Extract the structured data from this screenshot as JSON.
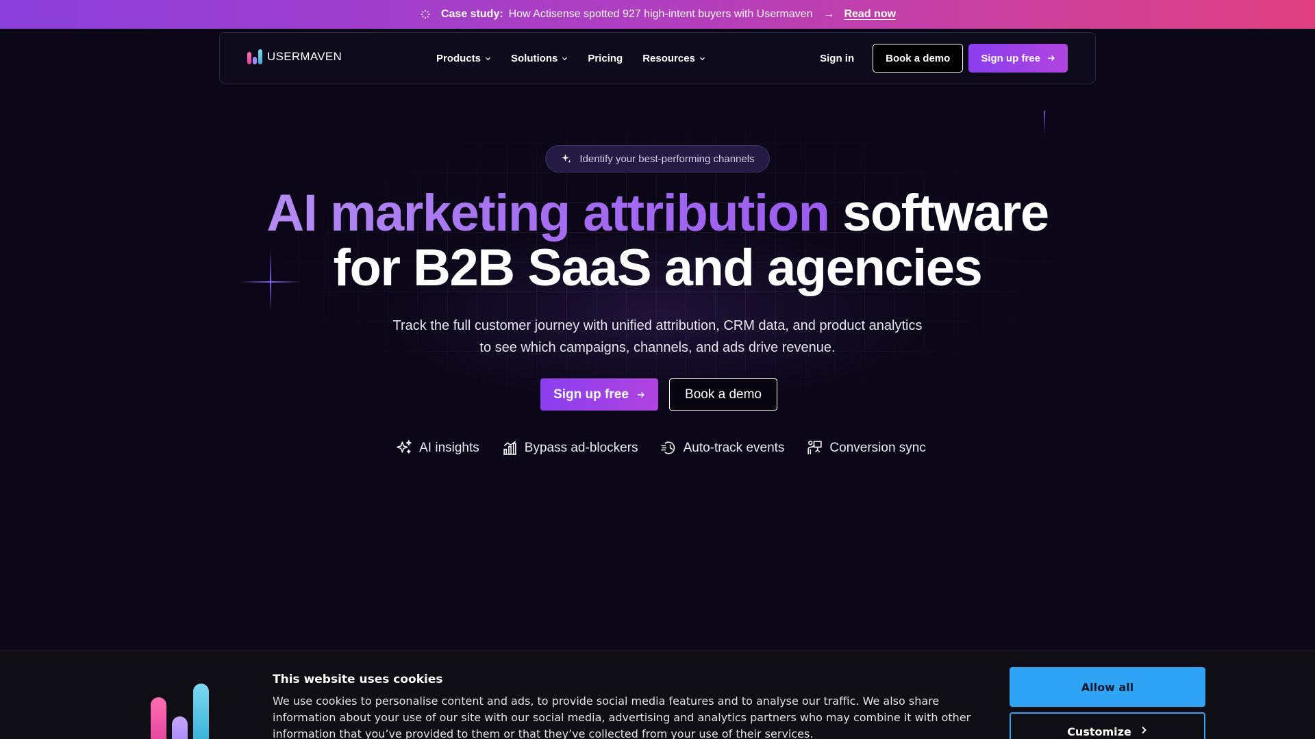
{
  "announcement": {
    "label": "Case study:",
    "text": "How Actisense spotted 927 high-intent buyers with Usermaven",
    "arrow": "→",
    "link": "Read now"
  },
  "nav": {
    "logo_text": "USERMAVEN",
    "menu": [
      {
        "label": "Products",
        "has_dropdown": true
      },
      {
        "label": "Solutions",
        "has_dropdown": true
      },
      {
        "label": "Pricing",
        "has_dropdown": false
      },
      {
        "label": "Resources",
        "has_dropdown": true
      }
    ],
    "signin": "Sign in",
    "book_demo": "Book a demo",
    "signup": "Sign up free"
  },
  "hero": {
    "pill": "Identify your best-performing channels",
    "headline_highlight": "AI marketing attribution",
    "headline_rest_1": " software",
    "headline_line2": "for B2B SaaS and agencies",
    "sub_line1": "Track the full customer journey with unified attribution, CRM data, and product analytics",
    "sub_line2": "to see which campaigns, channels, and ads drive revenue.",
    "cta_primary": "Sign up free",
    "cta_secondary": "Book a demo",
    "features": [
      {
        "label": "AI insights",
        "icon": "sparkles-icon"
      },
      {
        "label": "Bypass ad-blockers",
        "icon": "bar-chart-icon"
      },
      {
        "label": "Auto-track events",
        "icon": "fast-clock-icon"
      },
      {
        "label": "Conversion sync",
        "icon": "presenter-icon"
      }
    ]
  },
  "cookie": {
    "title": "This website uses cookies",
    "text": "We use cookies to personalise content and ads, to provide social media features and to analyse our traffic. We also share information about your use of our site with our social media, advertising and analytics partners who may combine it with other information that you’ve provided to them or that they’ve collected from your use of their services.",
    "allow": "Allow all",
    "customize": "Customize"
  },
  "colors": {
    "background": "#0b0718",
    "accent_purple": "#8a3ef0",
    "accent_pink": "#e0407f",
    "cookie_blue": "#2fa3f6"
  }
}
